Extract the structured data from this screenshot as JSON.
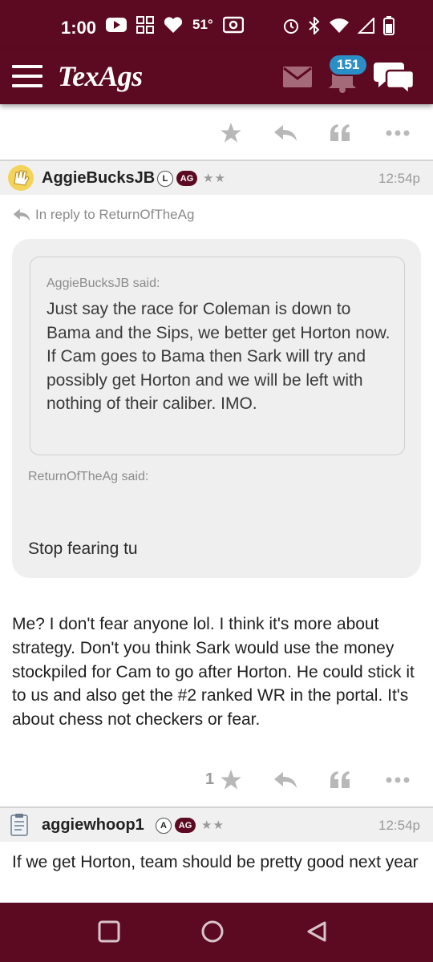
{
  "status_bar": {
    "time": "1:00",
    "temperature": "51°",
    "icons": [
      "youtube-icon",
      "grid-app-icon",
      "heart-icon",
      "radio-icon",
      "alarm-icon",
      "bluetooth-icon",
      "wifi-icon",
      "signal-icon",
      "battery-icon"
    ]
  },
  "app_bar": {
    "logo": "TexAgs",
    "notification_count": "151",
    "icons": [
      "menu-icon",
      "mail-icon",
      "bell-icon",
      "chat-icon"
    ]
  },
  "colors": {
    "brand_maroon": "#5c0a21",
    "badge_blue": "#2a8fc7",
    "action_gray": "#b8b8b8",
    "header_gray": "#f0f0f0"
  },
  "post1": {
    "username": "AggieBucksJB",
    "rank_badge": "L",
    "ag_badge": "AG",
    "stars": "★★",
    "time": "12:54p",
    "reply_to": "In reply to ReturnOfTheAg",
    "quote_inner_said": "AggieBucksJB said:",
    "quote_inner_text": "Just say the race for Coleman is down to Bama and the Sips, we better get Horton now. If Cam goes to Bama then Sark will try and possibly get Horton and we will be left with nothing of their caliber. IMO.",
    "quote_outer_said": "ReturnOfTheAg said:",
    "quote_outer_text": "Stop fearing tu",
    "body": "Me? I don't fear anyone lol. I think it's more about strategy. Don't you think Sark would use the money stockpiled for Cam to go after Horton. He could stick it to us and also get the #2 ranked WR in the portal. It's about chess not checkers or fear.",
    "star_count": "1"
  },
  "post2": {
    "username": "aggiewhoop1",
    "rank_badge": "A",
    "ag_badge": "AG",
    "stars": "★★",
    "time": "12:54p",
    "body": "If we get Horton, team should be pretty good next year"
  },
  "nav_bar": {
    "icons": [
      "recents-icon",
      "home-icon",
      "back-icon"
    ]
  }
}
